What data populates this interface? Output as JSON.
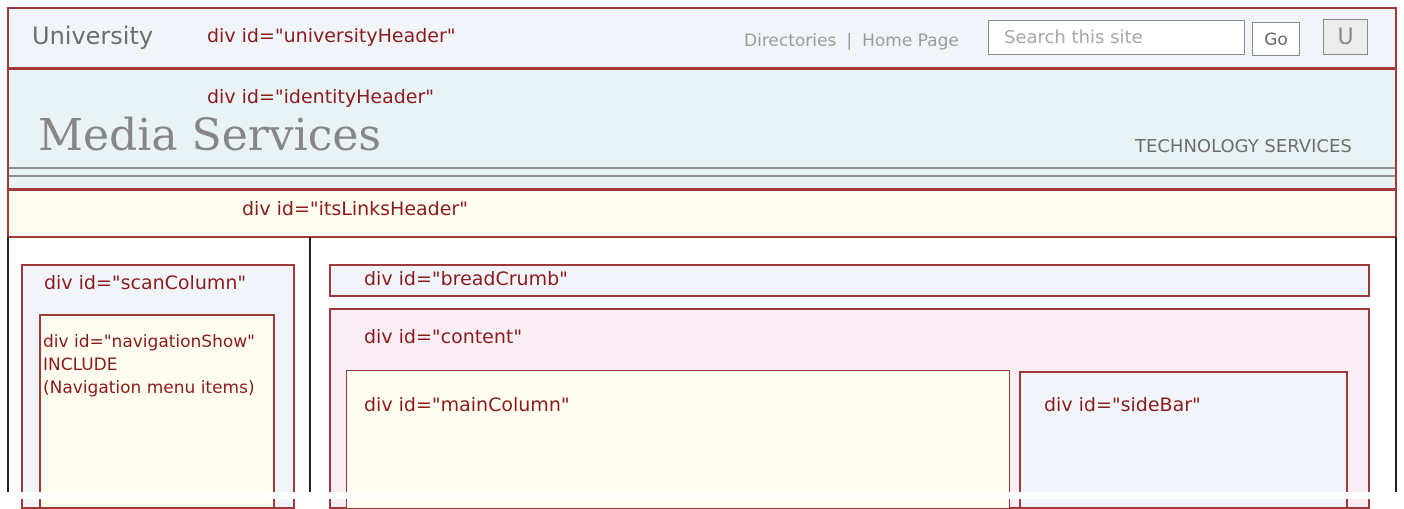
{
  "university_header": {
    "name": "University",
    "div_label": "div id=\"universityHeader\"",
    "links": [
      "Directories",
      "Home Page"
    ],
    "separator": "|",
    "search_placeholder": "Search this site",
    "go_label": "Go",
    "u_label": "U"
  },
  "identity_header": {
    "div_label": "div id=\"identityHeader\"",
    "title": "Media Services",
    "right_label": "TECHNOLOGY SERVICES"
  },
  "links_header": {
    "div_label": "div id=\"itsLinksHeader\""
  },
  "scan_column": {
    "div_label": "div id=\"scanColumn\"",
    "nav_lines": [
      "div id=\"navigationShow\"",
      "INCLUDE",
      "(Navigation menu items)"
    ]
  },
  "breadcrumb": {
    "div_label": "div id=\"breadCrumb\""
  },
  "content": {
    "div_label": "div id=\"content\"",
    "main_label": "div id=\"mainColumn\"",
    "side_label": "div id=\"sideBar\""
  },
  "colors": {
    "label_red": "#8b1a1a",
    "border_red": "#a03a3a",
    "header_blue": "#f1f5fa",
    "identity_blue": "#e9f2f5",
    "cream": "#fffdf0",
    "content_pink": "#f8eef3"
  }
}
